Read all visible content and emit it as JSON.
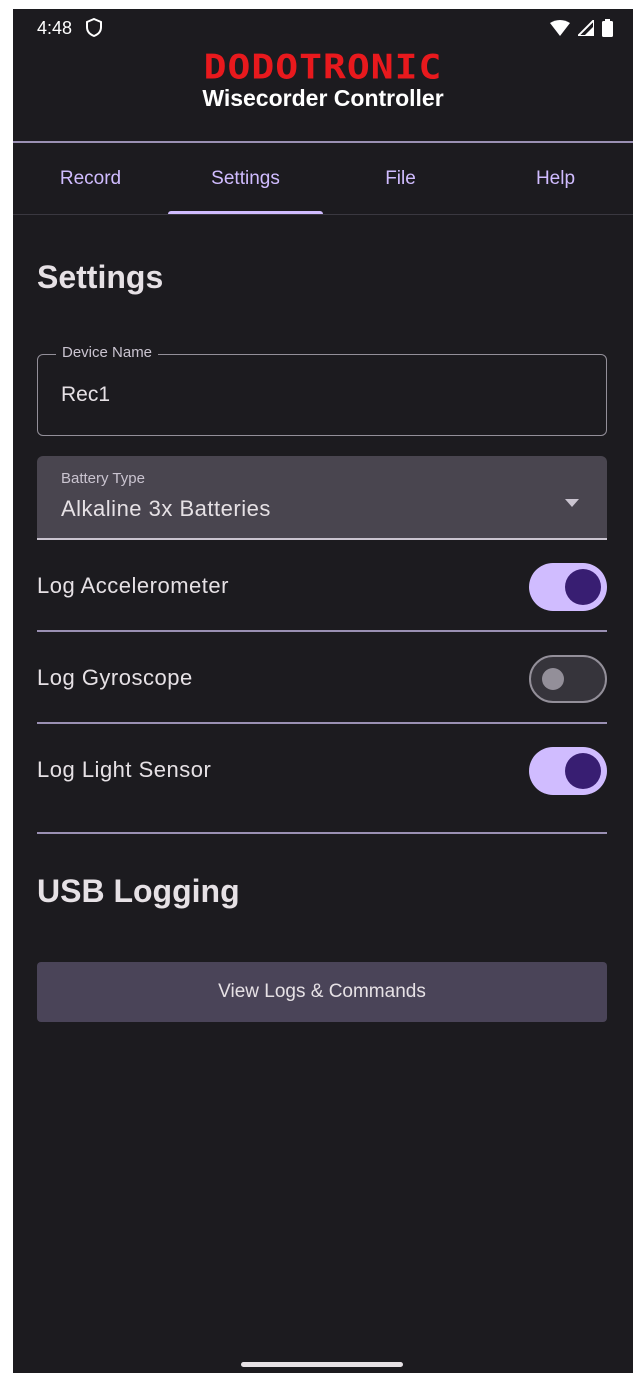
{
  "status_bar": {
    "time": "4:48",
    "icons": [
      "shield-icon",
      "wifi-icon",
      "signal-icon",
      "battery-icon"
    ]
  },
  "header": {
    "brand": "DODOTRONIC",
    "title": "Wisecorder Controller",
    "brand_color": "#e8191d"
  },
  "tabs": [
    {
      "label": "Record",
      "active": false
    },
    {
      "label": "Settings",
      "active": true
    },
    {
      "label": "File",
      "active": false
    },
    {
      "label": "Help",
      "active": false
    }
  ],
  "settings": {
    "title": "Settings",
    "device_name": {
      "label": "Device Name",
      "value": "Rec1"
    },
    "battery_type": {
      "label": "Battery Type",
      "value": "Alkaline 3x Batteries"
    },
    "switches": [
      {
        "label": "Log Accelerometer",
        "on": true
      },
      {
        "label": "Log Gyroscope",
        "on": false
      },
      {
        "label": "Log Light Sensor",
        "on": true
      }
    ]
  },
  "usb": {
    "title": "USB Logging",
    "button_label": "View Logs & Commands"
  },
  "colors": {
    "background": "#1c1b1f",
    "accent": "#d0bcff",
    "switch_knob_on": "#381e72",
    "button_bg": "#4a4458"
  }
}
